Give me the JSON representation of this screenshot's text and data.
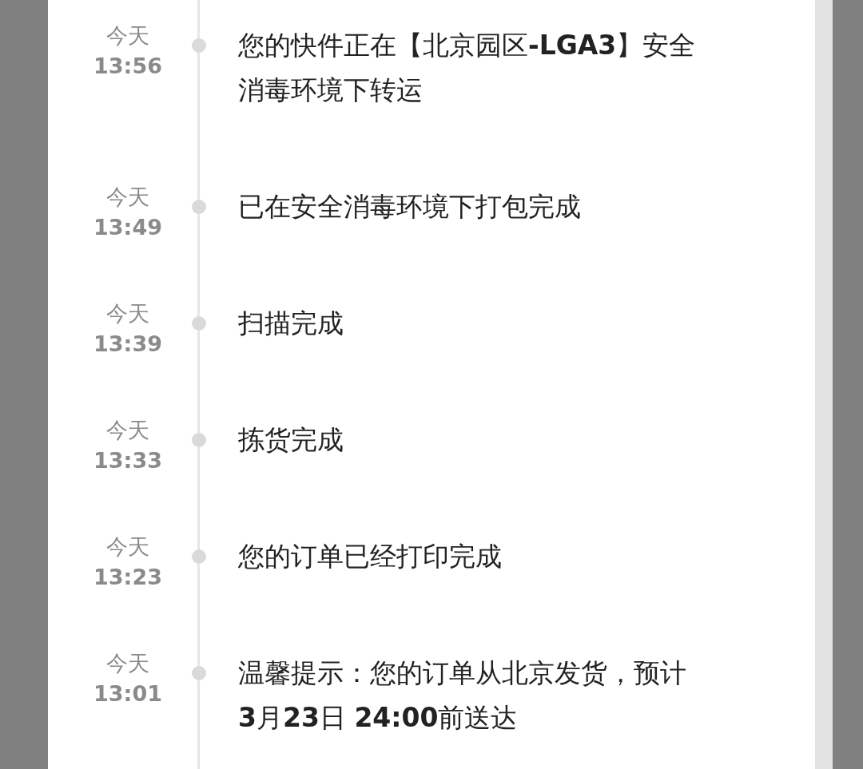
{
  "events": [
    {
      "day": "今天",
      "time": "13:56",
      "text": "您的快件正在【北京园区**-LGA3**】安全消毒环境下转运"
    },
    {
      "day": "今天",
      "time": "13:49",
      "text": "已在安全消毒环境下打包完成"
    },
    {
      "day": "今天",
      "time": "13:39",
      "text": "扫描完成"
    },
    {
      "day": "今天",
      "time": "13:33",
      "text": "拣货完成"
    },
    {
      "day": "今天",
      "time": "13:23",
      "text": "您的订单已经打印完成"
    },
    {
      "day": "今天",
      "time": "13:01",
      "text": "温馨提示：您的订单从北京发货，预计**3**月**23**日 **24:00**前送达"
    }
  ]
}
